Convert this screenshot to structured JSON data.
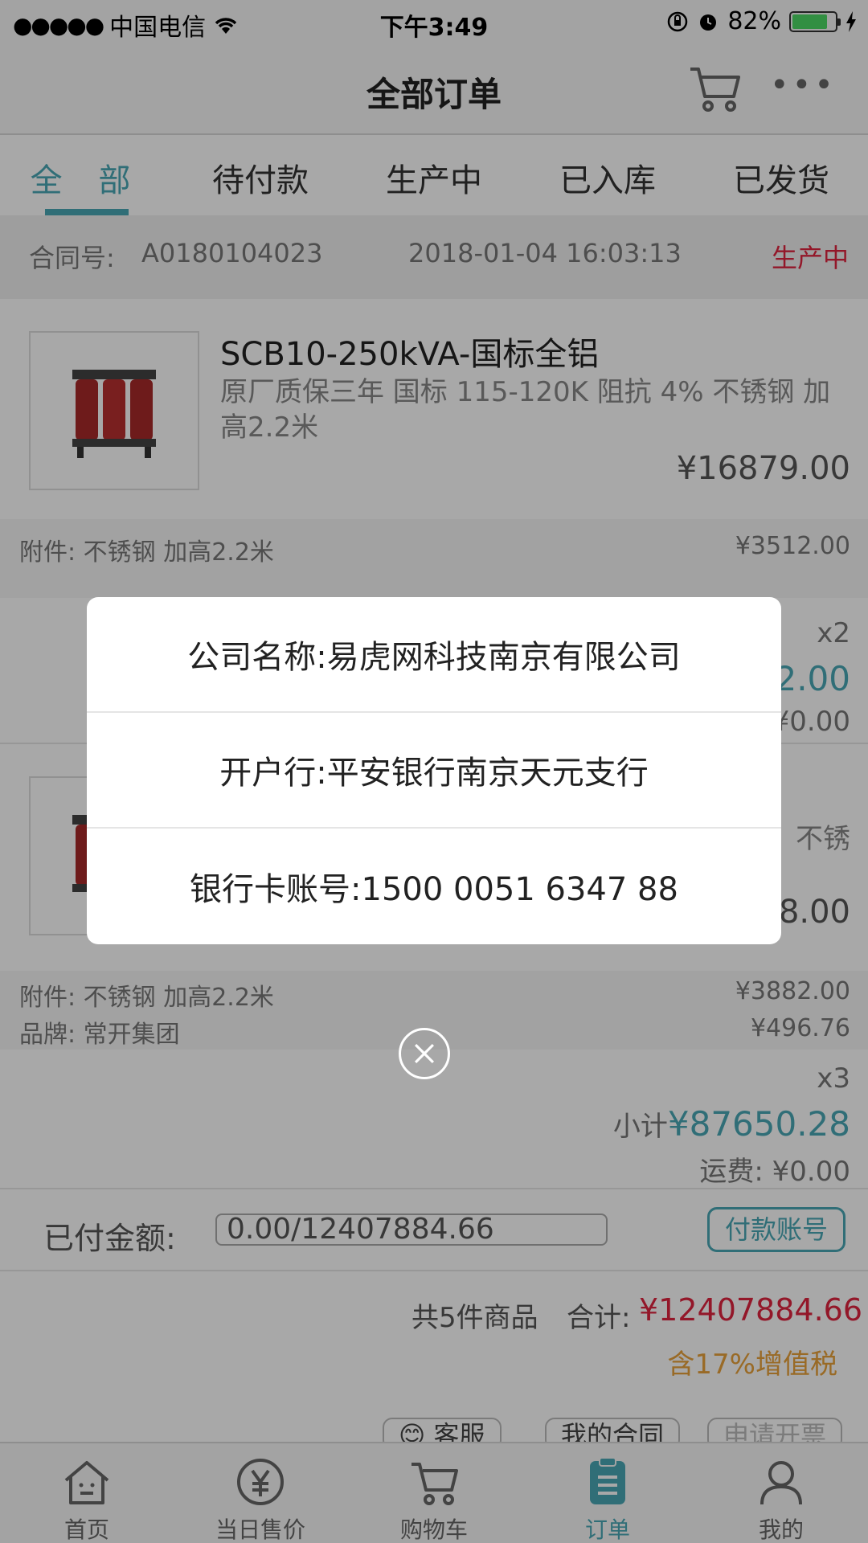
{
  "status_bar": {
    "carrier": "中国电信",
    "time": "下午3:49",
    "battery": "82%"
  },
  "nav": {
    "title": "全部订单"
  },
  "tabs": [
    {
      "label": "全 部",
      "active": true
    },
    {
      "label": "待付款"
    },
    {
      "label": "生产中"
    },
    {
      "label": "已入库"
    },
    {
      "label": "已发货"
    }
  ],
  "order": {
    "contract_label": "合同号:",
    "contract_no": "A0180104023",
    "datetime": "2018-01-04 16:03:13",
    "status": "生产中"
  },
  "products": [
    {
      "name": "SCB10-250kVA-国标全铝",
      "desc": "原厂质保三年 国标 115-120K 阻抗 4% 不锈钢 加高2.2米",
      "price": "¥16879.00",
      "extras": [
        {
          "label": "附件:",
          "value": "不锈钢 加高2.2米",
          "price": "¥3512.00"
        }
      ],
      "qty": "x2",
      "subtotal_partial": "2.00",
      "freight_partial": "¥0.00"
    },
    {
      "desc_partial": "不锈",
      "price_partial": "8.00",
      "extras": [
        {
          "label": "附件:",
          "value": "不锈钢 加高2.2米",
          "price": "¥3882.00"
        },
        {
          "label": "品牌:",
          "value": "常开集团",
          "price": "¥496.76"
        }
      ],
      "qty": "x3",
      "subtotal_label": "小计",
      "subtotal": "¥87650.28",
      "freight": "运费:  ¥0.00"
    }
  ],
  "paid": {
    "label": "已付金额:",
    "value": "0.00/12407884.66",
    "button": "付款账号"
  },
  "total": {
    "count": "共5件商品",
    "label": "合计:",
    "value": "¥12407884.66",
    "tax": "含17%增值税"
  },
  "actions": [
    {
      "label": "😊 客服"
    },
    {
      "label": "我的合同"
    },
    {
      "label": "申请开票"
    }
  ],
  "tab_bar": [
    {
      "label": "首页",
      "icon": "home-icon"
    },
    {
      "label": "当日售价",
      "icon": "yuan-icon"
    },
    {
      "label": "购物车",
      "icon": "cart-icon"
    },
    {
      "label": "订单",
      "icon": "order-icon",
      "active": true
    },
    {
      "label": "我的",
      "icon": "user-icon"
    }
  ],
  "modal": {
    "company": "公司名称:易虎网科技南京有限公司",
    "bank": "开户行:平安银行南京天元支行",
    "account": "银行卡账号:1500 0051 6347 88"
  },
  "colors": {
    "accent": "#4aa8b5",
    "status_red": "#e0243f",
    "tax_orange": "#e8a23a"
  }
}
